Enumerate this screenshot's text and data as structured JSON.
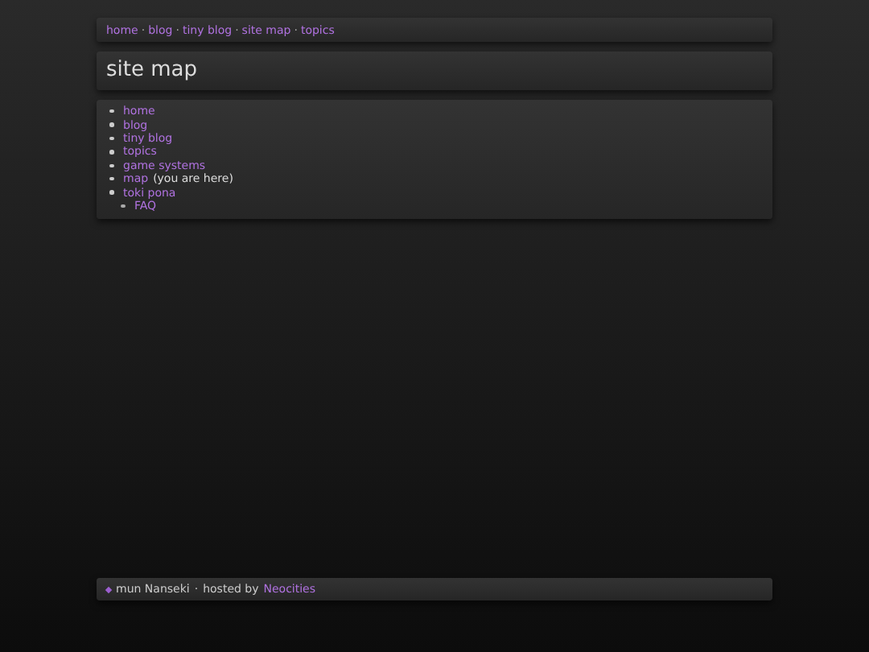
{
  "nav": [
    {
      "kind": "link",
      "text": "home"
    },
    {
      "kind": "separator",
      "text": "·"
    },
    {
      "kind": "link",
      "text": "blog"
    },
    {
      "kind": "separator",
      "text": "·"
    },
    {
      "kind": "link",
      "text": "tiny blog"
    },
    {
      "kind": "separator",
      "text": "·"
    },
    {
      "kind": "link",
      "text": "site map"
    },
    {
      "kind": "separator",
      "text": "·"
    },
    {
      "kind": "link",
      "text": "topics"
    }
  ],
  "title": "site map",
  "sitemap": [
    {
      "text": "home"
    },
    {
      "text": "blog"
    },
    {
      "text": "tiny blog"
    },
    {
      "text": "topics"
    },
    {
      "text": "game systems"
    },
    {
      "text": "map",
      "note": "(you are here)"
    },
    {
      "text": "toki pona",
      "children": [
        {
          "text": "FAQ"
        }
      ]
    }
  ],
  "footer": {
    "author": "mun Nanseki",
    "separator": "·",
    "hosted_by": "hosted by",
    "host": "Neocities"
  }
}
